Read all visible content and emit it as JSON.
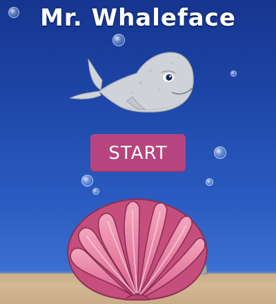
{
  "game": {
    "title": "Mr. Whaleface",
    "start_label": "START"
  },
  "colors": {
    "background_top": "#16358f",
    "background_bottom": "#5a86d6",
    "start_button": "#b6457f",
    "sand": "#cdb08b",
    "shell": "#e57aa0",
    "whale": "#cfd2d6"
  },
  "icons": {
    "mascot": "whale-icon",
    "decoration": "seashell-icon"
  }
}
